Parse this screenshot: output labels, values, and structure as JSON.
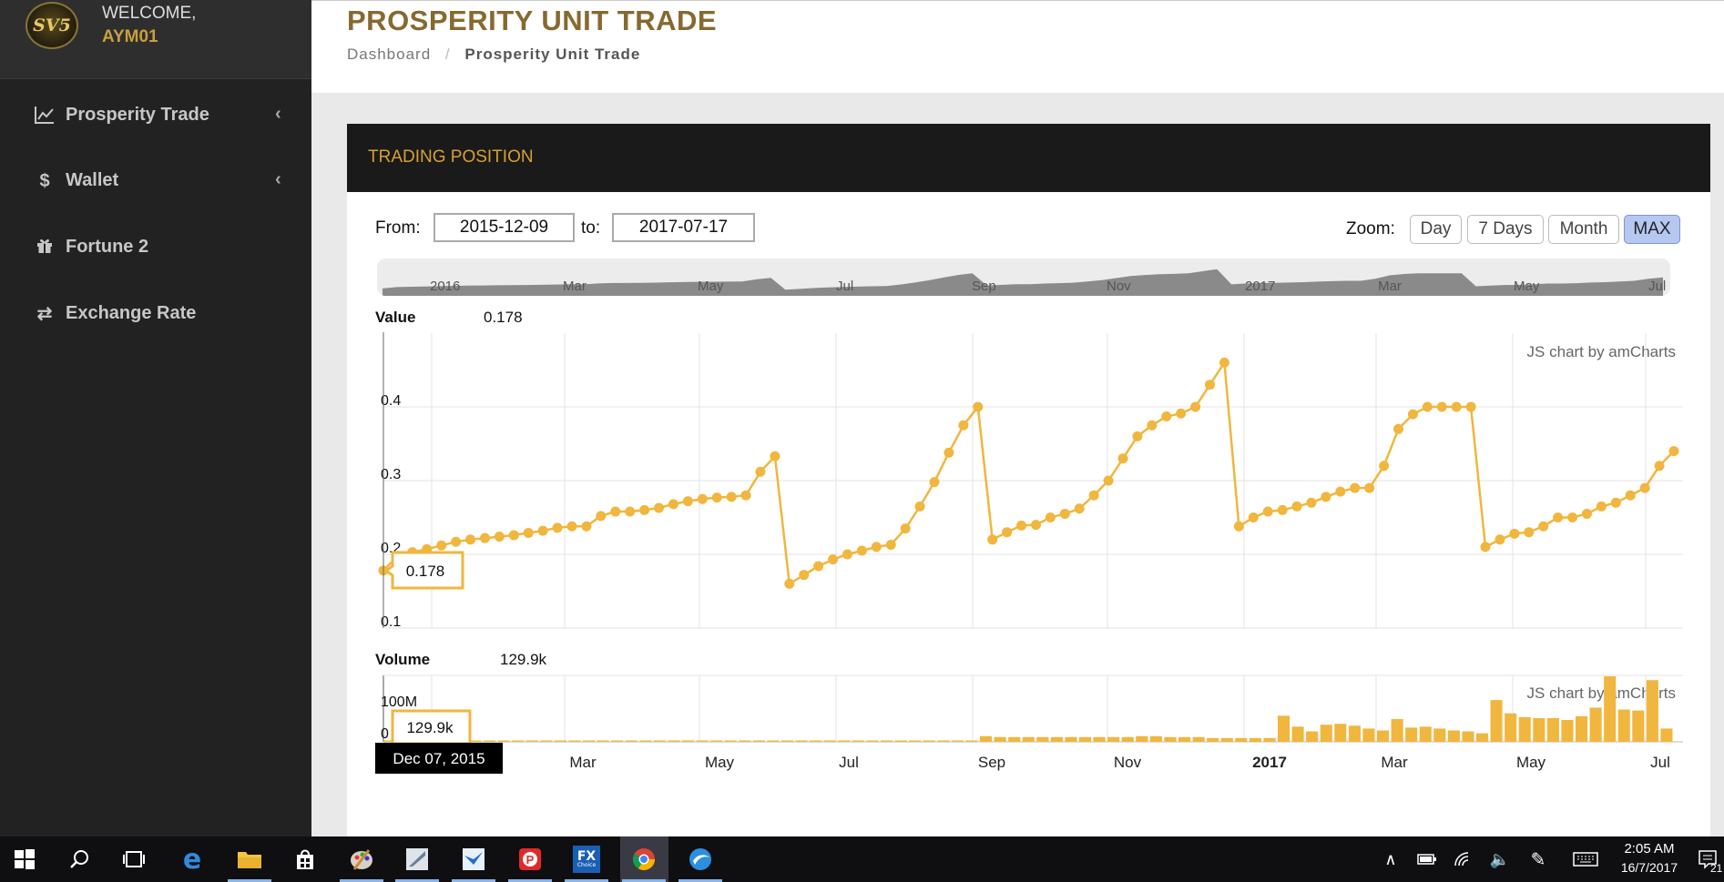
{
  "sidebar": {
    "logo_text": "SV5",
    "welcome": "WELCOME,",
    "username": "AYM01",
    "items": [
      {
        "label": "Prosperity Trade",
        "icon": "line-chart-icon",
        "chevron": "‹"
      },
      {
        "label": "Wallet",
        "icon": "dollar-icon",
        "chevron": "‹"
      },
      {
        "label": "Fortune 2",
        "icon": "gift-icon"
      },
      {
        "label": "Exchange Rate",
        "icon": "exchange-icon"
      }
    ]
  },
  "header": {
    "title": "PROSPERITY UNIT TRADE",
    "breadcrumb_home": "Dashboard",
    "breadcrumb_sep": "/",
    "breadcrumb_current": "Prosperity Unit Trade"
  },
  "panel": {
    "title": "TRADING POSITION",
    "from_label": "From:",
    "from_value": "2015-12-09",
    "to_label": "to:",
    "to_value": "2017-07-17",
    "zoom_label": "Zoom:",
    "zoom_buttons": [
      "Day",
      "7 Days",
      "Month",
      "MAX"
    ],
    "zoom_active": "MAX"
  },
  "chart_data": {
    "type": "line",
    "credit": "JS chart by amCharts",
    "scrollbar_labels": [
      "2016",
      "Mar",
      "May",
      "Jul",
      "Sep",
      "Nov",
      "2017",
      "Mar",
      "May",
      "Jul"
    ],
    "x_labels": [
      "Mar",
      "May",
      "Jul",
      "Sep",
      "Nov",
      "2017",
      "Mar",
      "May",
      "Jul"
    ],
    "cursor_date": "Dec 07, 2015",
    "value_panel": {
      "label": "Value",
      "current": "0.178",
      "balloon": "0.178",
      "y_ticks": [
        "0.1",
        "0.2",
        "0.3",
        "0.4"
      ],
      "ylim": [
        0.1,
        0.5
      ],
      "color": "#f0b63e",
      "values": [
        0.178,
        0.198,
        0.203,
        0.207,
        0.212,
        0.217,
        0.22,
        0.222,
        0.224,
        0.226,
        0.229,
        0.232,
        0.236,
        0.238,
        0.238,
        0.252,
        0.258,
        0.258,
        0.26,
        0.263,
        0.268,
        0.272,
        0.275,
        0.277,
        0.278,
        0.28,
        0.312,
        0.333,
        0.16,
        0.172,
        0.184,
        0.193,
        0.2,
        0.205,
        0.21,
        0.213,
        0.235,
        0.265,
        0.298,
        0.338,
        0.375,
        0.4,
        0.22,
        0.23,
        0.239,
        0.24,
        0.25,
        0.255,
        0.262,
        0.28,
        0.3,
        0.33,
        0.36,
        0.375,
        0.387,
        0.391,
        0.4,
        0.43,
        0.46,
        0.238,
        0.25,
        0.258,
        0.26,
        0.265,
        0.27,
        0.278,
        0.285,
        0.29,
        0.29,
        0.32,
        0.37,
        0.39,
        0.4,
        0.4,
        0.4,
        0.4,
        0.21,
        0.22,
        0.228,
        0.23,
        0.238,
        0.25,
        0.25,
        0.255,
        0.265,
        0.27,
        0.28,
        0.29,
        0.32,
        0.34
      ]
    },
    "volume_panel": {
      "label": "Volume",
      "current": "129.9k",
      "balloon": "129.9k",
      "y_ticks": [
        "0",
        "100M"
      ],
      "color": "#f0b63e",
      "values_millions": [
        0.13,
        0.5,
        0.5,
        0.5,
        0.5,
        0.5,
        0.5,
        0.5,
        0.5,
        0.5,
        0.5,
        0.5,
        0.5,
        0.5,
        0.5,
        0.5,
        0.5,
        0.5,
        0.5,
        0.5,
        0.5,
        0.5,
        0.5,
        0.5,
        0.5,
        0.5,
        0.5,
        0.5,
        0.5,
        0.5,
        0.5,
        0.5,
        0.5,
        0.5,
        0.5,
        0.5,
        0.5,
        0.5,
        0.5,
        0.5,
        0.5,
        0.5,
        12,
        10,
        10,
        10,
        10,
        10,
        10,
        10,
        10,
        10,
        10,
        12,
        12,
        10,
        10,
        10,
        8,
        8,
        8,
        8,
        8,
        55,
        32,
        22,
        36,
        38,
        34,
        28,
        24,
        48,
        30,
        32,
        28,
        24,
        22,
        18,
        88,
        60,
        52,
        50,
        50,
        46,
        54,
        72,
        138,
        68,
        66,
        130,
        28
      ]
    }
  },
  "taskbar": {
    "icons": [
      "windows-start-icon",
      "search-icon",
      "task-view-icon",
      "edge-icon",
      "file-explorer-icon",
      "store-icon",
      "paint-icon",
      "app-icon",
      "mail-icon",
      "pinterest-icon",
      "fx-choice-icon",
      "chrome-icon",
      "browser-icon"
    ],
    "fx_text": "FX",
    "fx_sub": "Choice",
    "time": "2:05 AM",
    "date": "16/7/2017",
    "notification_count": "21"
  }
}
